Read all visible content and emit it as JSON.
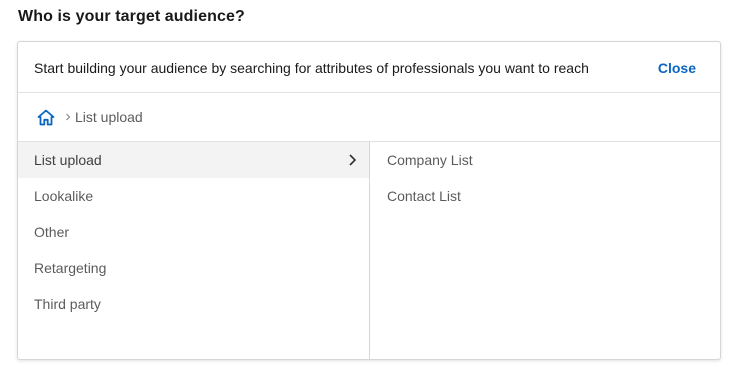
{
  "heading": "Who is your target audience?",
  "panel": {
    "intro": "Start building your audience by searching for attributes of professionals you want to reach",
    "close_label": "Close"
  },
  "breadcrumb": {
    "home_icon": "home-icon",
    "current": "List upload"
  },
  "categories": [
    {
      "label": "List upload",
      "selected": true
    },
    {
      "label": "Lookalike",
      "selected": false
    },
    {
      "label": "Other",
      "selected": false
    },
    {
      "label": "Retargeting",
      "selected": false
    },
    {
      "label": "Third party",
      "selected": false
    }
  ],
  "subcategories": [
    {
      "label": "Company List"
    },
    {
      "label": "Contact List"
    }
  ],
  "colors": {
    "accent": "#0a66c2",
    "selected_bg": "#f3f3f3",
    "border": "#d6d6d6"
  }
}
